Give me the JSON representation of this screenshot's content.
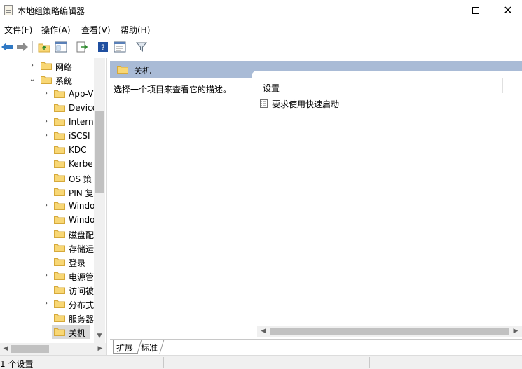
{
  "window": {
    "title": "本地组策略编辑器",
    "close_glyph": "✕"
  },
  "menu": {
    "file": "文件(F)",
    "action": "操作(A)",
    "view": "查看(V)",
    "help": "帮助(H)"
  },
  "toolbar": {
    "icons": [
      "back-arrow-icon",
      "forward-arrow-icon",
      "up-folder-icon",
      "show-hide-tree-icon",
      "export-list-icon",
      "help-icon",
      "properties-icon",
      "filter-icon"
    ],
    "colors": {
      "arrow": "#2f78c4",
      "help": "#1f4fa0",
      "filter": "#607080"
    }
  },
  "tree": {
    "items": [
      {
        "label": "网络",
        "expander": "›",
        "selected": false
      },
      {
        "label": "系统",
        "expander": "⌄",
        "selected": false
      },
      {
        "label": "App-V",
        "expander": "›",
        "selected": false
      },
      {
        "label": "Device",
        "expander": "",
        "selected": false
      },
      {
        "label": "Intern",
        "expander": "›",
        "selected": false
      },
      {
        "label": "iSCSI",
        "expander": "›",
        "selected": false
      },
      {
        "label": "KDC",
        "expander": "",
        "selected": false
      },
      {
        "label": "Kerbe",
        "expander": "",
        "selected": false
      },
      {
        "label": "OS 策",
        "expander": "",
        "selected": false
      },
      {
        "label": "PIN 复",
        "expander": "",
        "selected": false
      },
      {
        "label": "Windo",
        "expander": "›",
        "selected": false
      },
      {
        "label": "Windo",
        "expander": "",
        "selected": false
      },
      {
        "label": "磁盘配",
        "expander": "",
        "selected": false
      },
      {
        "label": "存储运",
        "expander": "",
        "selected": false
      },
      {
        "label": "登录",
        "expander": "",
        "selected": false
      },
      {
        "label": "电源管",
        "expander": "›",
        "selected": false
      },
      {
        "label": "访问被",
        "expander": "",
        "selected": false
      },
      {
        "label": "分布式",
        "expander": "›",
        "selected": false
      },
      {
        "label": "服务器",
        "expander": "",
        "selected": false
      },
      {
        "label": "关机",
        "expander": "",
        "selected": true
      }
    ]
  },
  "details": {
    "header_title": "关机",
    "description": "选择一个项目来查看它的描述。",
    "column_header": "设置",
    "settings": [
      {
        "label": "要求使用快速启动"
      }
    ]
  },
  "tabs": {
    "extended": "扩展",
    "standard": "标准"
  },
  "status": {
    "text": "1 个设置"
  },
  "colors": {
    "header_band": "#a9bbd6",
    "folder_fill": "#f8d775",
    "folder_stroke": "#d6a93a",
    "selection": "#d9d9d9"
  }
}
